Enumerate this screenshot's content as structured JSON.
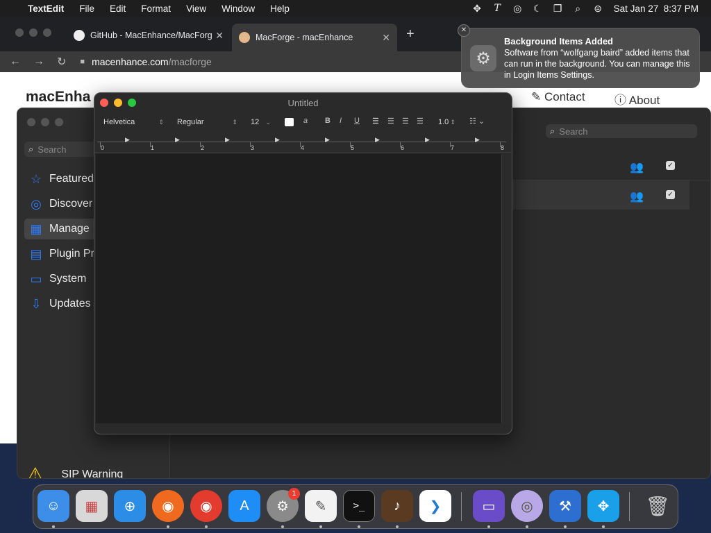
{
  "menubar": {
    "app": "TextEdit",
    "items": [
      "File",
      "Edit",
      "Format",
      "View",
      "Window",
      "Help"
    ],
    "clock": "Sat Jan 27  8:37 PM"
  },
  "browser": {
    "tabs": [
      {
        "title": "GitHub - MacEnhance/MacForg",
        "icon": "github-icon"
      },
      {
        "title": "MacForge - macEnhance",
        "icon": "macforge-icon"
      }
    ],
    "url_host": "macenhance.com",
    "url_path": "/macforge"
  },
  "website": {
    "logo": "macEnha",
    "nav": [
      {
        "label": "Contact"
      },
      {
        "label": "About"
      }
    ]
  },
  "macforge": {
    "search_left_placeholder": "Search",
    "search_right_placeholder": "Search",
    "sidebar": [
      {
        "label": "Featured",
        "icon": "star-icon"
      },
      {
        "label": "Discover",
        "icon": "discover-icon"
      },
      {
        "label": "Manage",
        "icon": "manage-icon"
      },
      {
        "label": "Plugin Pr",
        "icon": "plugin-icon"
      },
      {
        "label": "System",
        "icon": "display-icon"
      },
      {
        "label": "Updates",
        "icon": "download-icon"
      }
    ],
    "sip_warning": "SIP Warning"
  },
  "textedit": {
    "title": "Untitled",
    "font": "Helvetica",
    "style": "Regular",
    "size": "12",
    "bold": "B",
    "italic": "I",
    "underline": "U",
    "spacing": "1.0",
    "ruler": [
      "0",
      "1",
      "2",
      "3",
      "4",
      "5",
      "6",
      "7",
      "8"
    ]
  },
  "notification": {
    "title": "Background Items Added",
    "body": "Software from “wolfgang baird” added items that can run in the background. You can manage this in Login Items Settings."
  },
  "dock": {
    "apps": [
      "Finder",
      "Launchpad",
      "Safari",
      "Firefox",
      "Chrome",
      "App Store",
      "System Settings",
      "TextEdit",
      "Terminal",
      "GarageBand",
      "Visual Studio Code",
      "Drive",
      "Alfred",
      "Xcode",
      "Marker",
      "Trash"
    ],
    "badge": "1"
  }
}
